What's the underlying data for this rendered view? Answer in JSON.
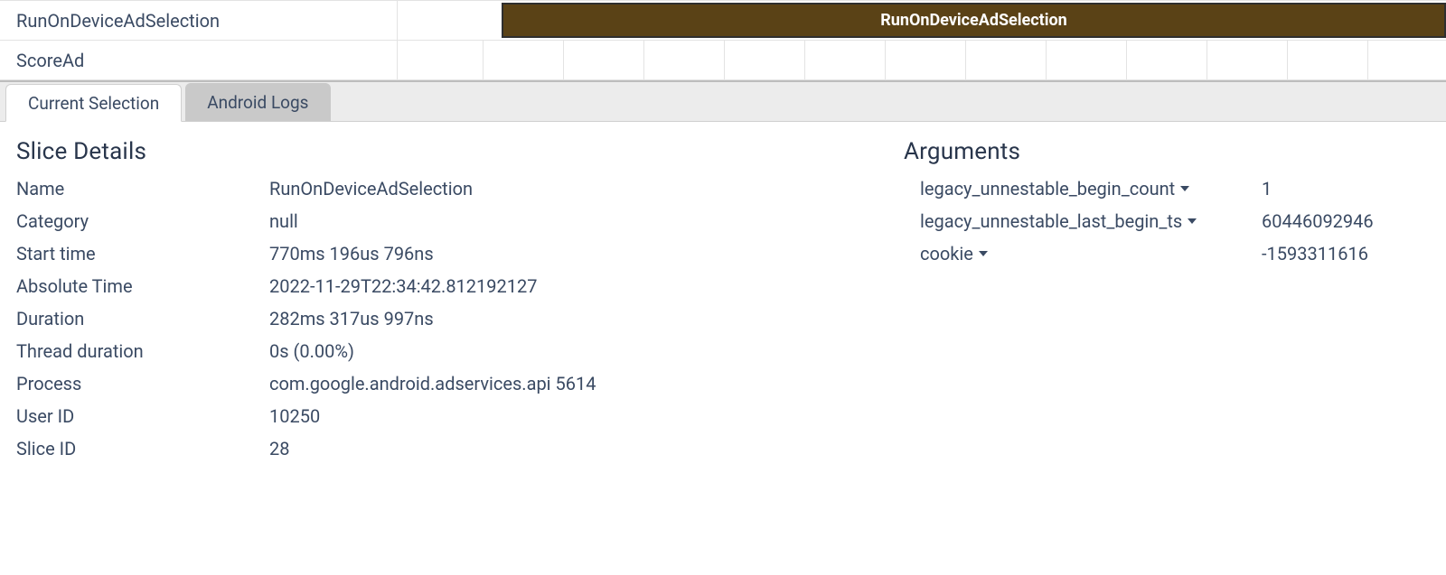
{
  "trace": {
    "rows": [
      {
        "name": "RunOnDeviceAdSelection"
      },
      {
        "name": "ScoreAd"
      }
    ],
    "slice_label": "RunOnDeviceAdSelection"
  },
  "tabs": {
    "current_selection": "Current Selection",
    "android_logs": "Android Logs"
  },
  "details": {
    "title": "Slice Details",
    "fields": {
      "name": {
        "label": "Name",
        "value": "RunOnDeviceAdSelection"
      },
      "category": {
        "label": "Category",
        "value": "null"
      },
      "start_time": {
        "label": "Start time",
        "value": "770ms 196us 796ns"
      },
      "absolute_time": {
        "label": "Absolute Time",
        "value": "2022-11-29T22:34:42.812192127"
      },
      "duration": {
        "label": "Duration",
        "value": "282ms 317us 997ns"
      },
      "thread_duration": {
        "label": "Thread duration",
        "value": "0s (0.00%)"
      },
      "process": {
        "label": "Process",
        "value": "com.google.android.adservices.api 5614"
      },
      "user_id": {
        "label": "User ID",
        "value": "10250"
      },
      "slice_id": {
        "label": "Slice ID",
        "value": "28"
      }
    }
  },
  "arguments": {
    "title": "Arguments",
    "items": {
      "begin_count": {
        "key": "legacy_unnestable_begin_count",
        "value": "1"
      },
      "begin_ts": {
        "key": "legacy_unnestable_last_begin_ts",
        "value": "60446092946"
      },
      "cookie": {
        "key": "cookie",
        "value": "-1593311616"
      }
    }
  }
}
